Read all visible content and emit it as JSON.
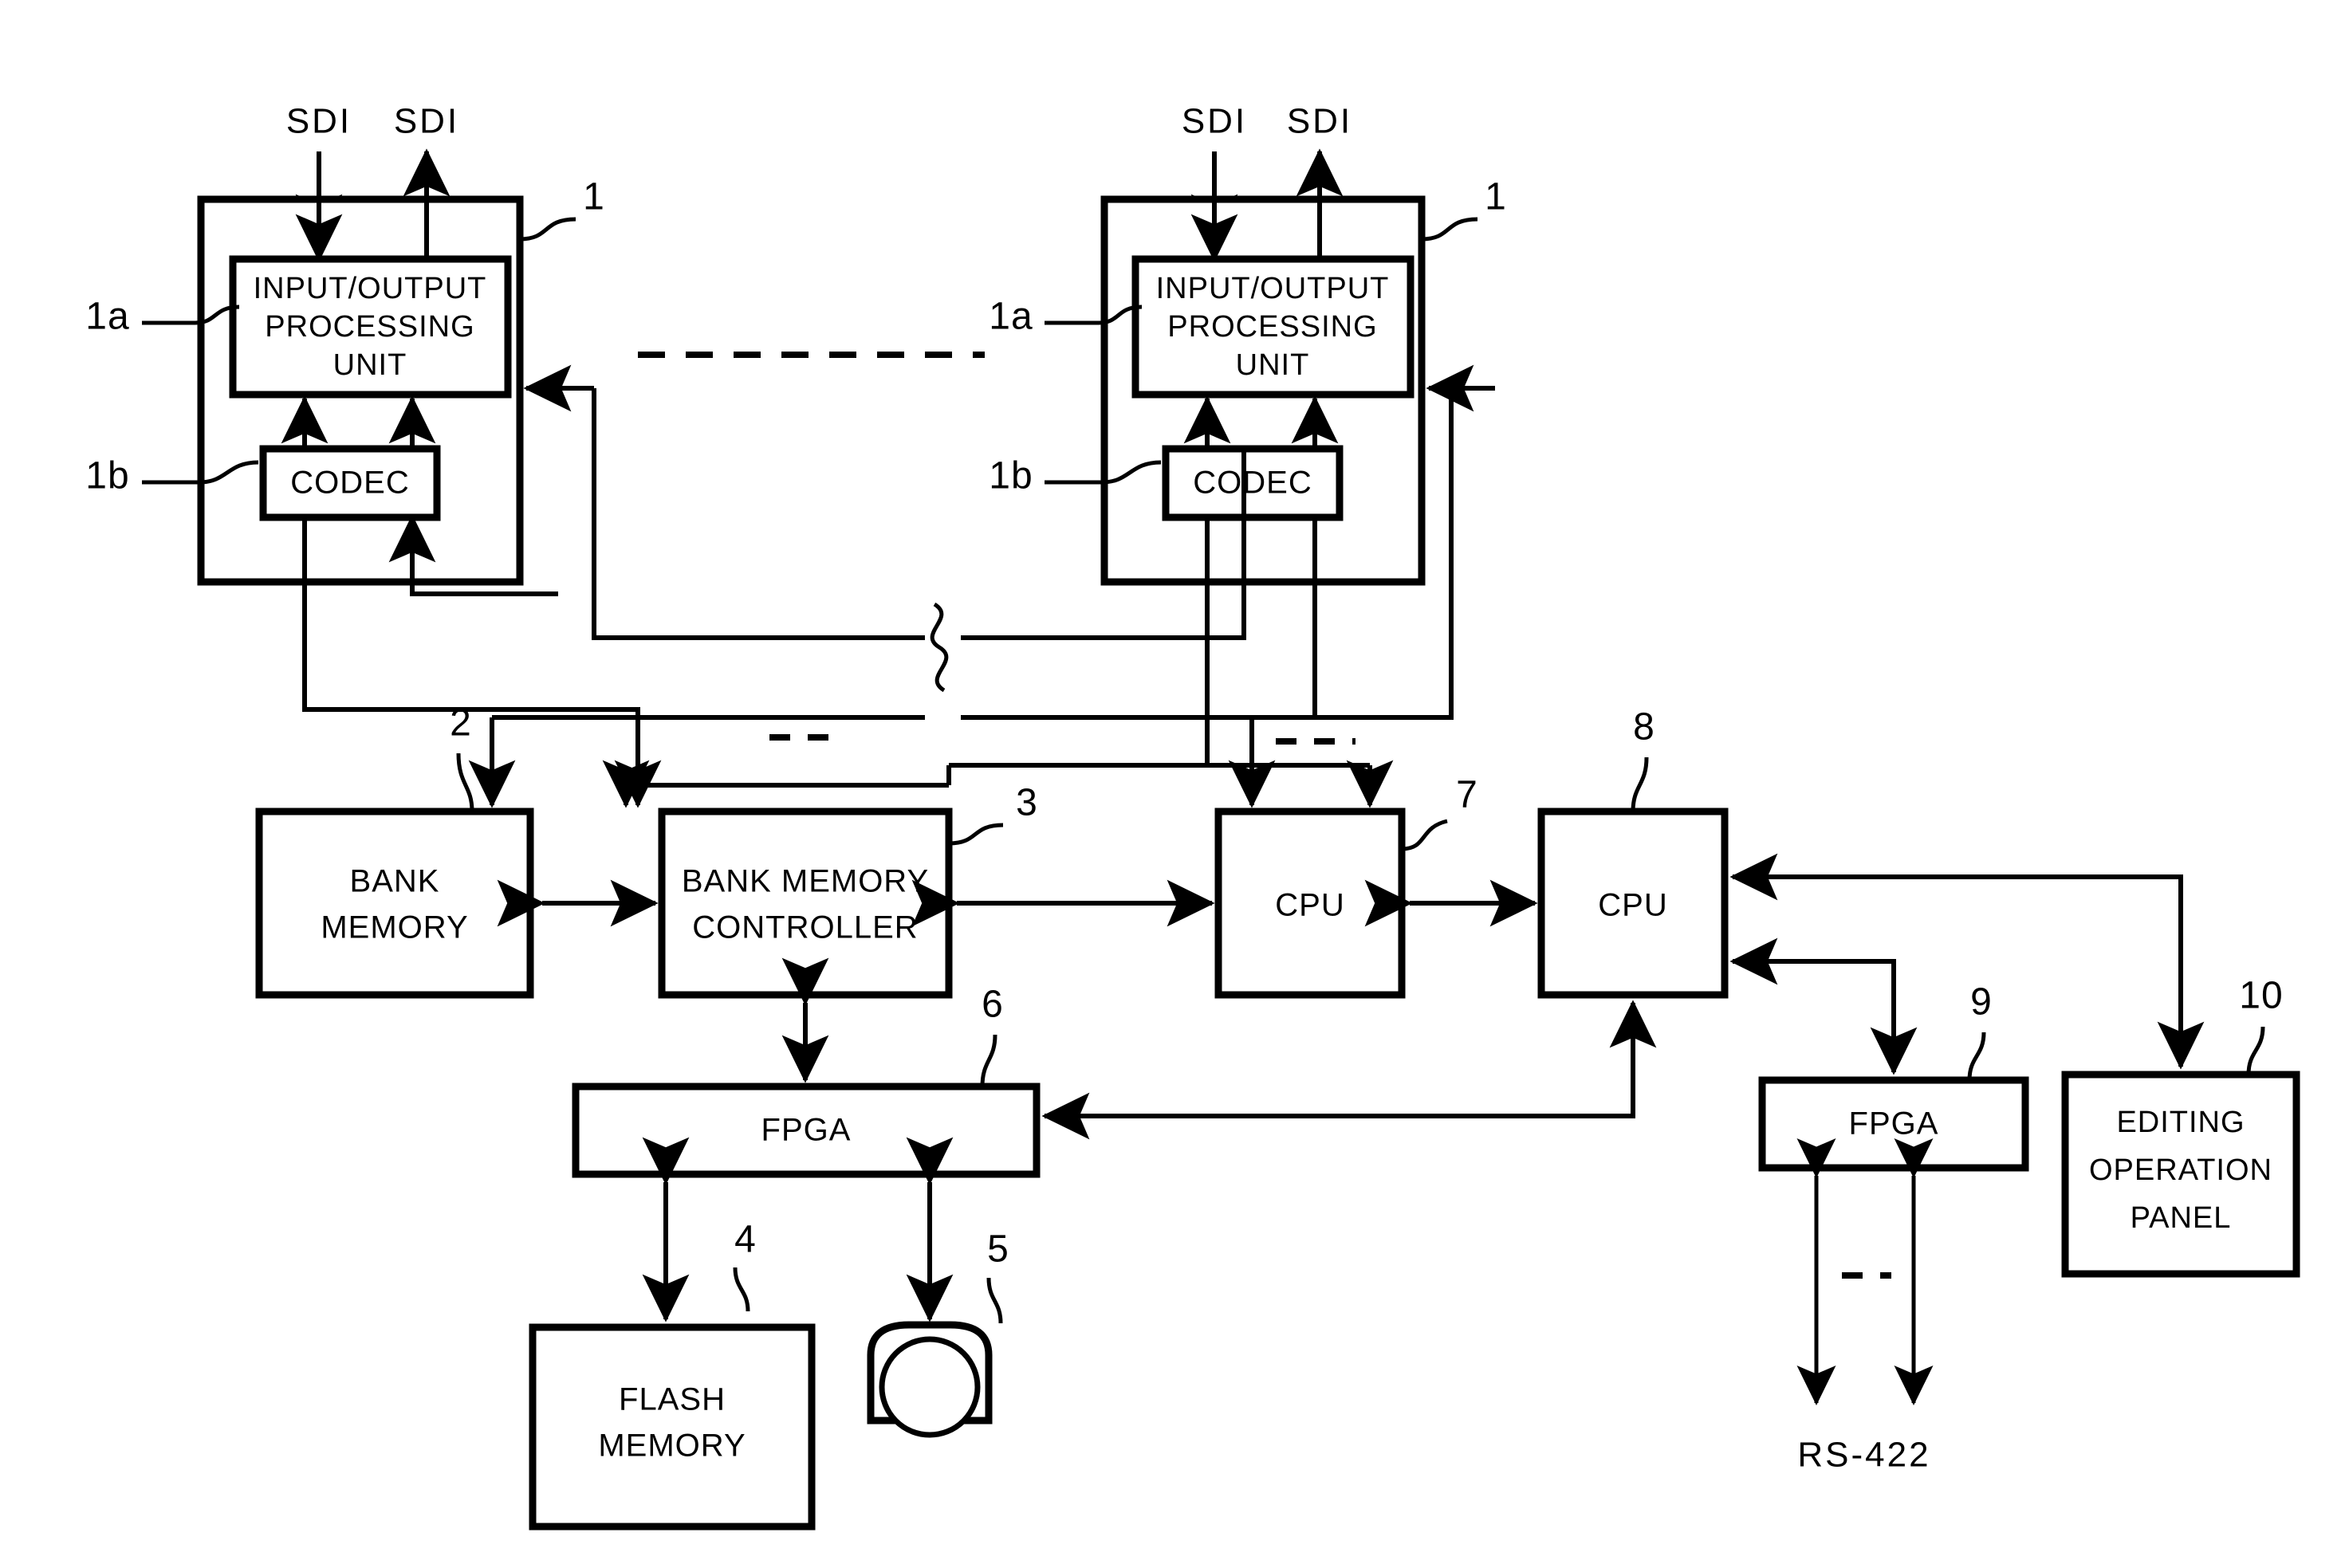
{
  "figure": {
    "type": "patent-block-diagram",
    "background_color": "#ffffff",
    "line_color": "#000000"
  },
  "signals": {
    "sdi_in_left": "SDI",
    "sdi_out_left": "SDI",
    "sdi_in_right": "SDI",
    "sdi_out_right": "SDI",
    "serial_bus": "RS-422"
  },
  "modules": {
    "left_module": {
      "ref": "1",
      "io_unit": {
        "ref": "1a",
        "label_line1": "INPUT/OUTPUT",
        "label_line2": "PROCESSING",
        "label_line3": "UNIT"
      },
      "codec": {
        "ref": "1b",
        "label": "CODEC"
      }
    },
    "right_module": {
      "ref": "1",
      "io_unit": {
        "ref": "1a",
        "label_line1": "INPUT/OUTPUT",
        "label_line2": "PROCESSING",
        "label_line3": "UNIT"
      },
      "codec": {
        "ref": "1b",
        "label": "CODEC"
      }
    }
  },
  "blocks": [
    {
      "id": "bank-memory",
      "ref": "2",
      "label_line1": "BANK",
      "label_line2": "MEMORY"
    },
    {
      "id": "bank-memory-controller",
      "ref": "3",
      "label_line1": "BANK MEMORY",
      "label_line2": "CONTROLLER"
    },
    {
      "id": "flash-memory",
      "ref": "4",
      "label_line1": "FLASH",
      "label_line2": "MEMORY"
    },
    {
      "id": "disk-drive",
      "ref": "5",
      "label_line1": "",
      "label_line2": ""
    },
    {
      "id": "fpga-left",
      "ref": "6",
      "label_line1": "FPGA",
      "label_line2": ""
    },
    {
      "id": "cpu-7",
      "ref": "7",
      "label_line1": "CPU",
      "label_line2": ""
    },
    {
      "id": "cpu-8",
      "ref": "8",
      "label_line1": "CPU",
      "label_line2": ""
    },
    {
      "id": "fpga-right",
      "ref": "9",
      "label_line1": "FPGA",
      "label_line2": ""
    },
    {
      "id": "editing-operation-panel",
      "ref": "10",
      "label_line1": "EDITING",
      "label_line2": "OPERATION",
      "label_line3": "PANEL"
    }
  ],
  "reference_numerals": [
    "1",
    "1a",
    "1b",
    "2",
    "3",
    "4",
    "5",
    "6",
    "7",
    "8",
    "9",
    "10"
  ]
}
